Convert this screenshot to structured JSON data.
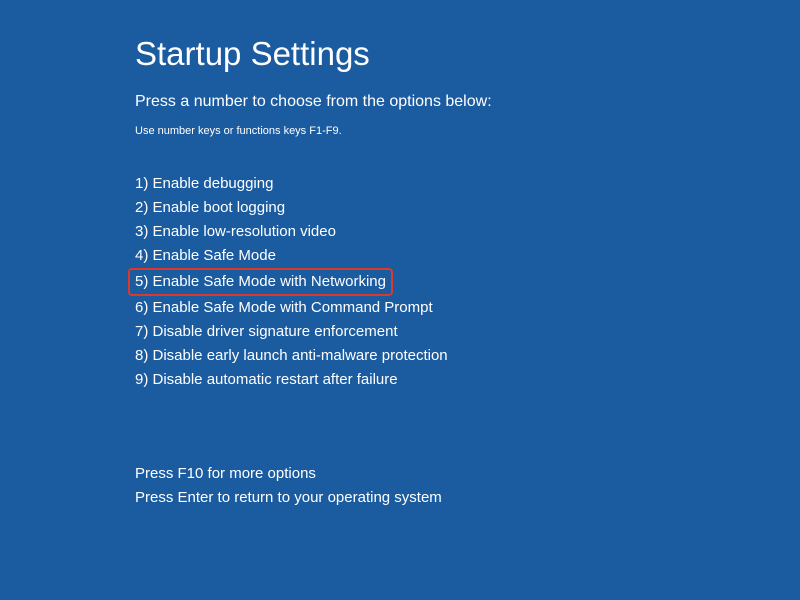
{
  "title": "Startup Settings",
  "subtitle": "Press a number to choose from the options below:",
  "hint": "Use number keys or functions keys F1-F9.",
  "options": [
    {
      "label": "1) Enable debugging",
      "highlighted": false
    },
    {
      "label": "2) Enable boot logging",
      "highlighted": false
    },
    {
      "label": "3) Enable low-resolution video",
      "highlighted": false
    },
    {
      "label": "4) Enable Safe Mode",
      "highlighted": false
    },
    {
      "label": "5) Enable Safe Mode with Networking",
      "highlighted": true
    },
    {
      "label": "6) Enable Safe Mode with Command Prompt",
      "highlighted": false
    },
    {
      "label": "7) Disable driver signature enforcement",
      "highlighted": false
    },
    {
      "label": "8) Disable early launch anti-malware protection",
      "highlighted": false
    },
    {
      "label": "9) Disable automatic restart after failure",
      "highlighted": false
    }
  ],
  "footer": {
    "line1": "Press F10 for more options",
    "line2": "Press Enter to return to your operating system"
  },
  "colors": {
    "background": "#1b5ba0",
    "text": "#ffffff",
    "highlight_border": "#d93a2b"
  }
}
